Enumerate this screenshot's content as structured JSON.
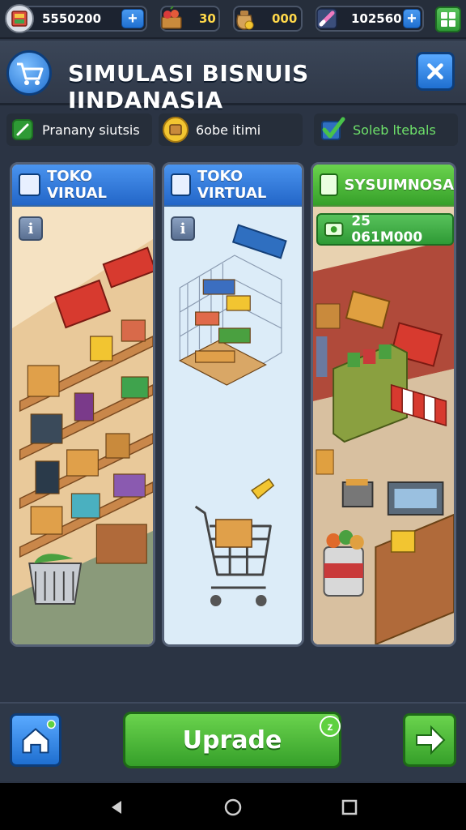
{
  "resources": {
    "coins": "5550200",
    "food": "30",
    "goods": "000",
    "energy": "102560"
  },
  "header": {
    "title": "SIMULASI BISNUIS IINDANASIA"
  },
  "filters": [
    {
      "label": "Pranany siutsis"
    },
    {
      "label": "6obe itimi"
    },
    {
      "label": "Soleb ltebals"
    }
  ],
  "cards": [
    {
      "title": "TOKO VIRUAL",
      "info": "i"
    },
    {
      "title": "TOKO VIRTUAL",
      "info": "i"
    },
    {
      "title": "SYSUIMNOSA",
      "value": "25 061M000"
    }
  ],
  "actions": {
    "upgrade_label": "Uprade",
    "upgrade_badge": "z"
  },
  "colors": {
    "accent_blue": "#1f6fd0",
    "accent_green": "#36a02a",
    "background": "#2b3444"
  }
}
